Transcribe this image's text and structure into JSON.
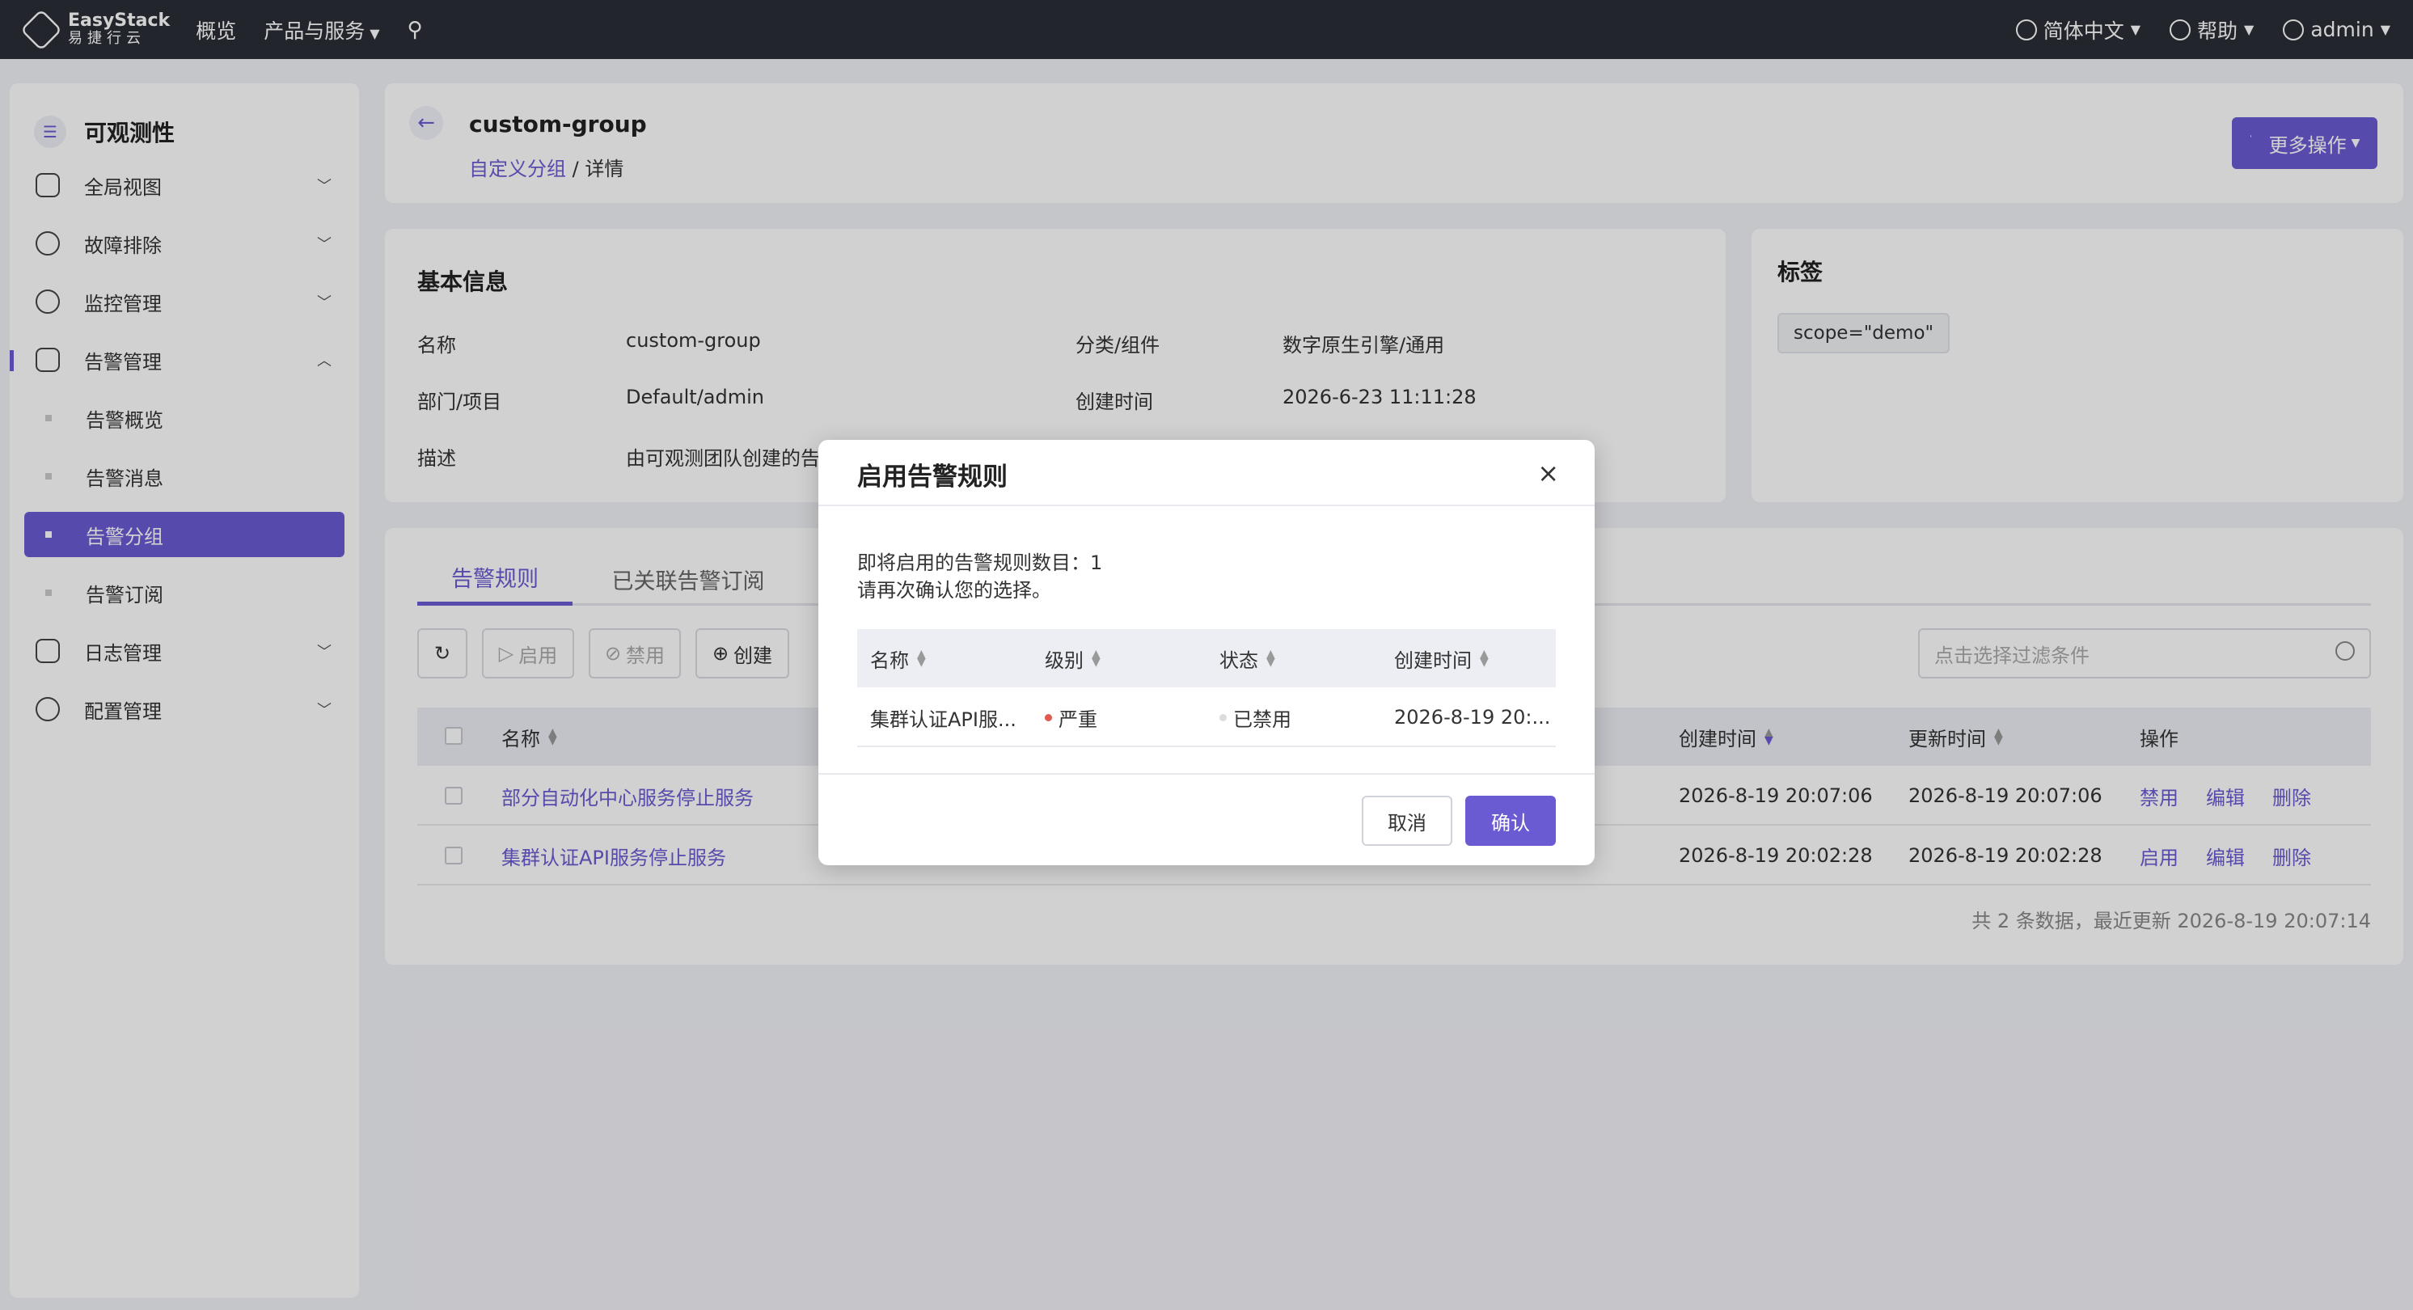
{
  "topbar": {
    "logo_en": "EasyStack",
    "logo_cn": "易捷行云",
    "nav_overview": "概览",
    "nav_products": "产品与服务",
    "lang": "简体中文",
    "help": "帮助",
    "user": "admin"
  },
  "sidebar": {
    "title": "可观测性",
    "items": [
      {
        "label": "全局视图"
      },
      {
        "label": "故障排除"
      },
      {
        "label": "监控管理"
      },
      {
        "label": "告警管理"
      },
      {
        "label": "日志管理"
      },
      {
        "label": "配置管理"
      }
    ],
    "sub_items": [
      {
        "label": "告警概览"
      },
      {
        "label": "告警消息"
      },
      {
        "label": "告警分组"
      },
      {
        "label": "告警订阅"
      }
    ]
  },
  "header": {
    "title": "custom-group",
    "crumb_link": "自定义分组",
    "crumb_sep": "/",
    "crumb_current": "详情",
    "more_actions": "更多操作"
  },
  "basic_info": {
    "title": "基本信息",
    "name_label": "名称",
    "name_value": "custom-group",
    "category_label": "分类/组件",
    "category_value": "数字原生引擎/通用",
    "dept_label": "部门/项目",
    "dept_value": "Default/admin",
    "created_label": "创建时间",
    "created_value": "2026-6-23 11:11:28",
    "desc_label": "描述",
    "desc_value": "由可观测团队创建的告"
  },
  "tags": {
    "title": "标签",
    "chip": "scope=\"demo\""
  },
  "rules": {
    "tabs": [
      "告警规则",
      "已关联告警订阅"
    ],
    "btn_enable": "启用",
    "btn_disable": "禁用",
    "btn_create": "创建",
    "filter_placeholder": "点击选择过滤条件",
    "columns": {
      "name": "名称",
      "created": "创建时间",
      "updated": "更新时间",
      "actions": "操作"
    },
    "rows": [
      {
        "name": "部分自动化中心服务停止服务",
        "created": "2026-8-19 20:07:06",
        "updated": "2026-8-19 20:07:06",
        "toggle": "禁用",
        "edit": "编辑",
        "delete": "删除"
      },
      {
        "name": "集群认证API服务停止服务",
        "created": "2026-8-19 20:02:28",
        "updated": "2026-8-19 20:02:28",
        "toggle": "启用",
        "edit": "编辑",
        "delete": "删除"
      }
    ],
    "footer": "共 2 条数据，最近更新  2026-8-19 20:07:14"
  },
  "modal": {
    "title": "启用告警规则",
    "close": "×",
    "line1": "即将启用的告警规则数目：1",
    "line2": "请再次确认您的选择。",
    "columns": {
      "name": "名称",
      "level": "级别",
      "status": "状态",
      "created": "创建时间"
    },
    "row": {
      "name": "集群认证API服...",
      "level": "严重",
      "status": "已禁用",
      "created": "2026-8-19 20:..."
    },
    "cancel": "取消",
    "confirm": "确认"
  },
  "colors": {
    "accent": "#6b5bd3",
    "topbar": "#2b2e36",
    "severity_critical": "#e05a4f",
    "status_disabled": "#cccccc"
  }
}
